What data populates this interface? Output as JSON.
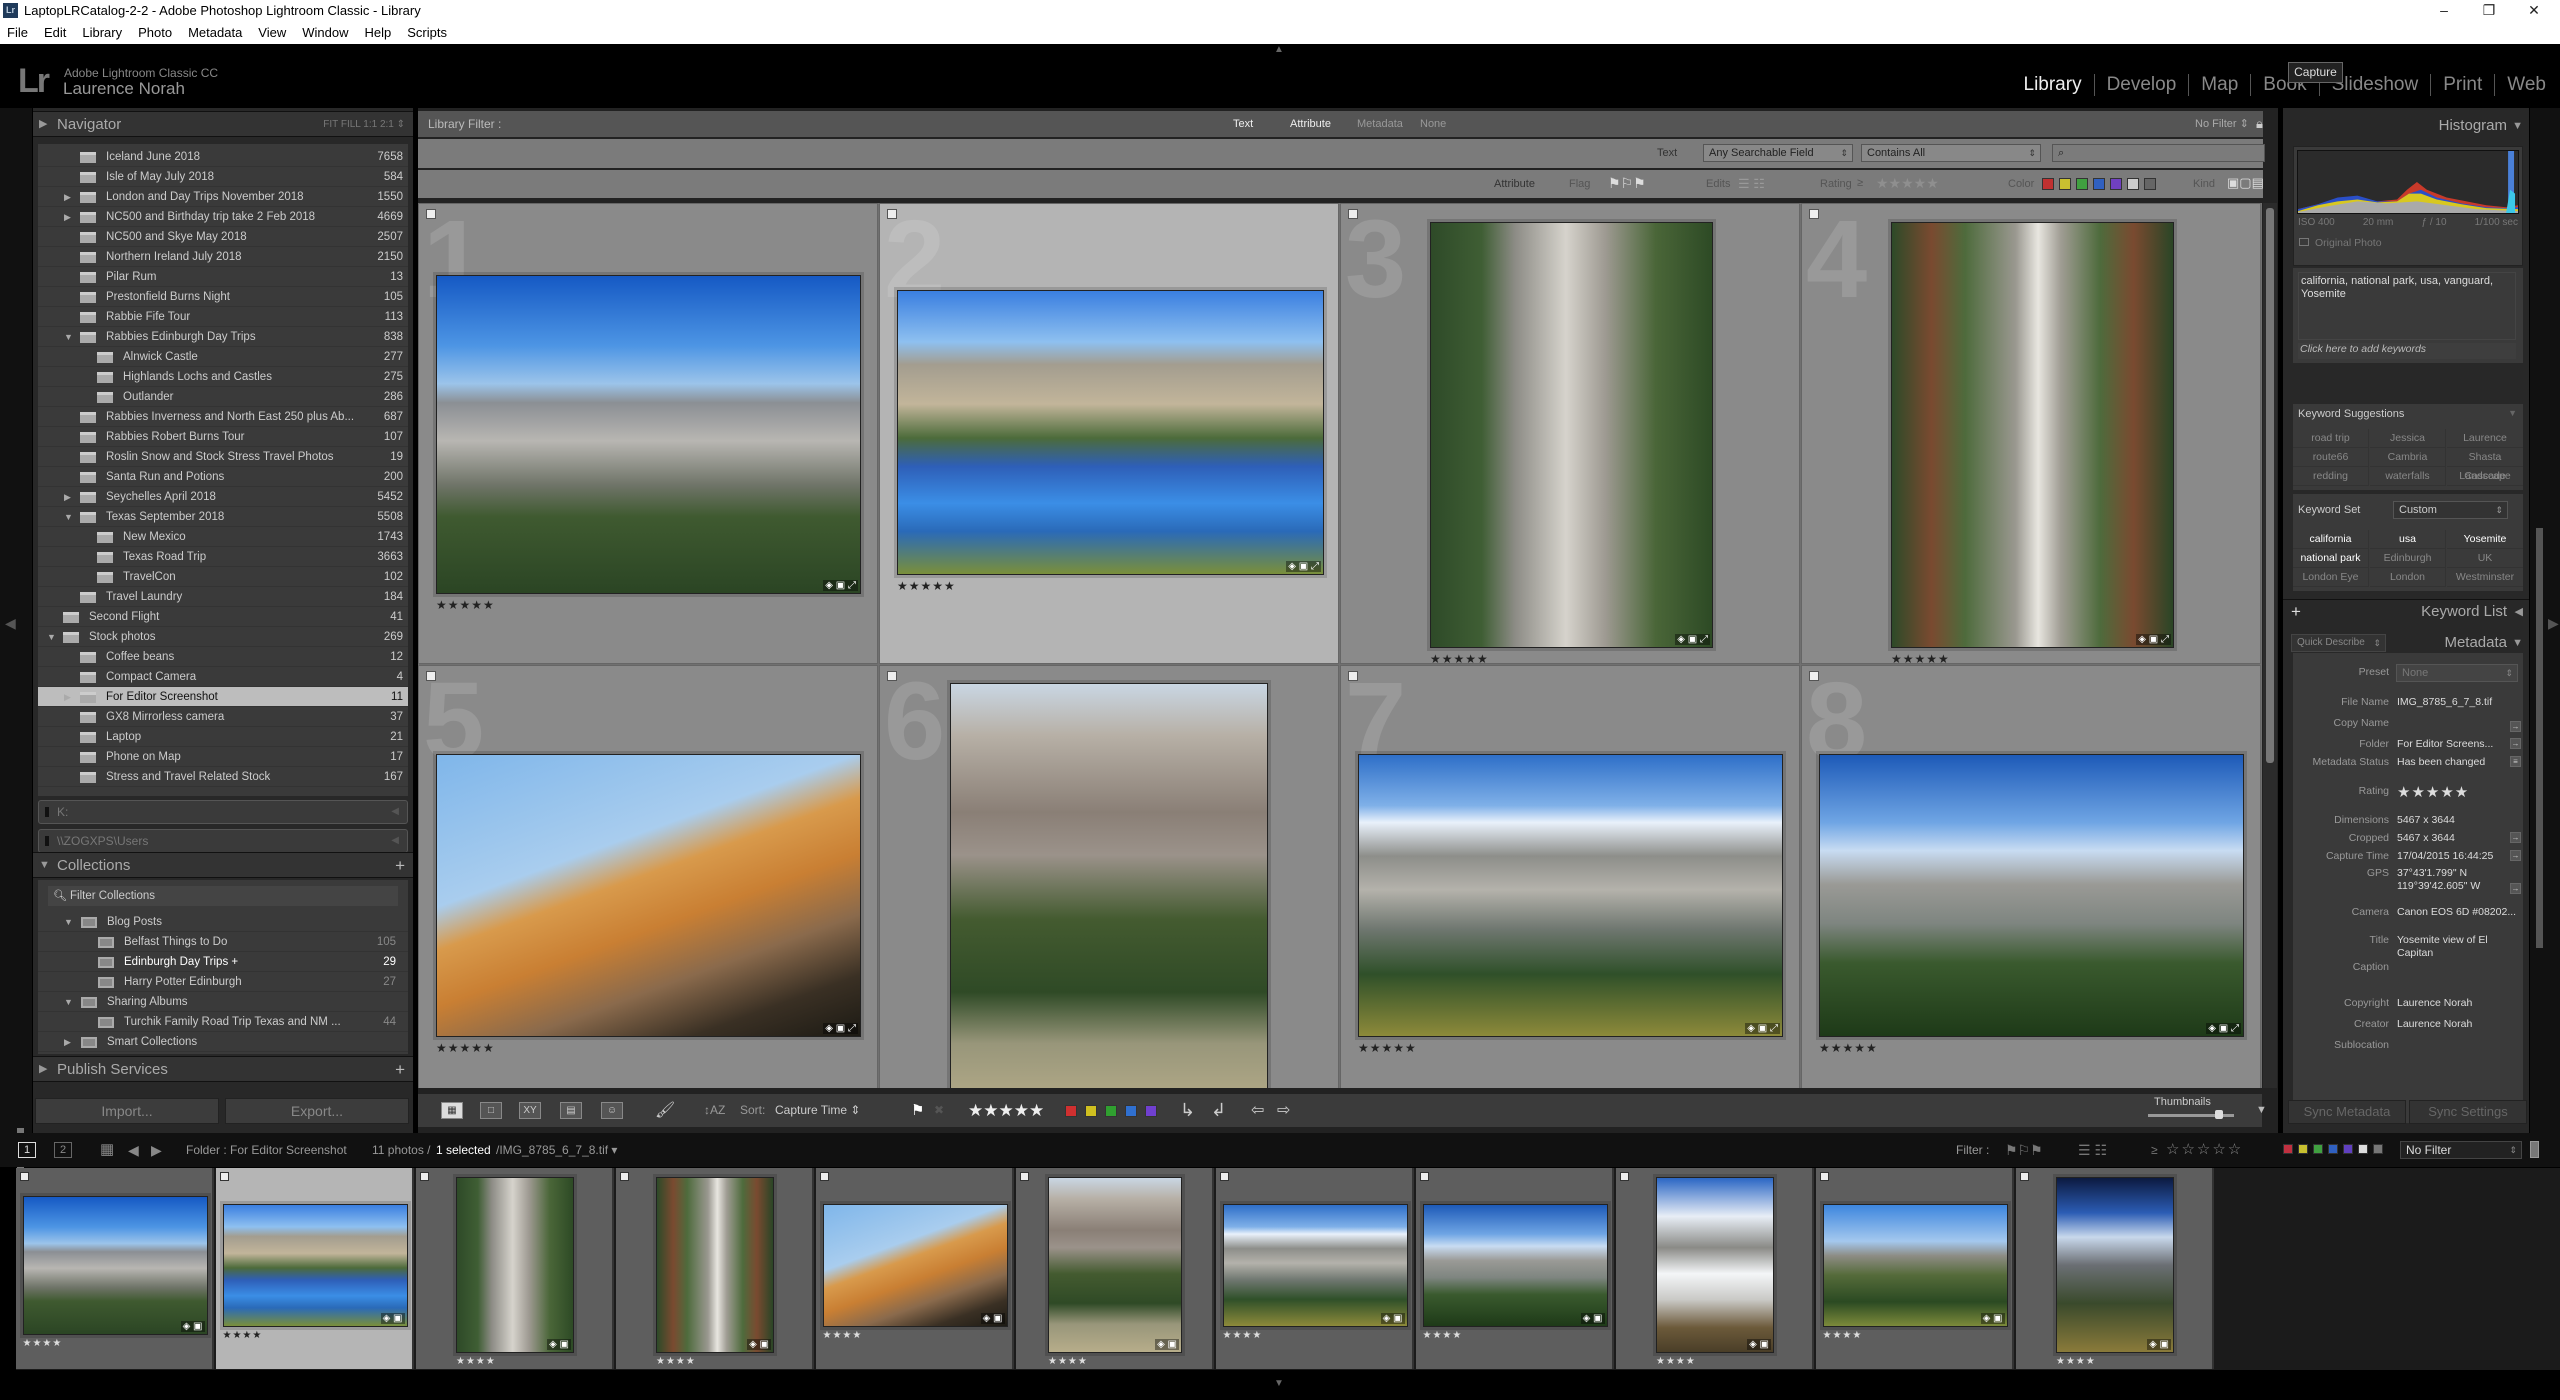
{
  "window": {
    "title": "LaptopLRCatalog-2-2 - Adobe Photoshop Lightroom Classic - Library",
    "app_icon": "Lr",
    "controls": {
      "minimize": "–",
      "maximize": "❐",
      "close": "✕"
    }
  },
  "menu": [
    "File",
    "Edit",
    "Library",
    "Photo",
    "Metadata",
    "View",
    "Window",
    "Help",
    "Scripts"
  ],
  "identity": {
    "logo": "Lr",
    "product": "Adobe Lightroom Classic CC",
    "user": "Laurence Norah"
  },
  "modules": [
    {
      "label": "Library",
      "active": true
    },
    {
      "label": "Develop"
    },
    {
      "label": "Map"
    },
    {
      "label": "Book"
    },
    {
      "label": "Slideshow"
    },
    {
      "label": "Print"
    },
    {
      "label": "Web"
    }
  ],
  "tooltip": "Capture",
  "navigator": {
    "title": "Navigator",
    "zoom_options": "FIT   FILL   1:1   2:1 ⇕"
  },
  "folders": [
    {
      "name": "Iceland June 2018",
      "count": "7658",
      "level": 1
    },
    {
      "name": "Isle of May July 2018",
      "count": "584",
      "level": 1
    },
    {
      "name": "London and Day Trips November 2018",
      "count": "1550",
      "level": 1,
      "state": "collapsed"
    },
    {
      "name": "NC500 and Birthday trip take 2 Feb 2018",
      "count": "4669",
      "level": 1,
      "state": "collapsed"
    },
    {
      "name": "NC500 and Skye May 2018",
      "count": "2507",
      "level": 1
    },
    {
      "name": "Northern Ireland July 2018",
      "count": "2150",
      "level": 1
    },
    {
      "name": "Pilar Rum",
      "count": "13",
      "level": 1
    },
    {
      "name": "Prestonfield Burns Night",
      "count": "105",
      "level": 1
    },
    {
      "name": "Rabbie Fife Tour",
      "count": "113",
      "level": 1
    },
    {
      "name": "Rabbies Edinburgh Day Trips",
      "count": "838",
      "level": 1,
      "state": "expanded"
    },
    {
      "name": "Alnwick Castle",
      "count": "277",
      "level": 2
    },
    {
      "name": "Highlands Lochs and Castles",
      "count": "275",
      "level": 2
    },
    {
      "name": "Outlander",
      "count": "286",
      "level": 2
    },
    {
      "name": "Rabbies Inverness and North East 250 plus Ab...",
      "count": "687",
      "level": 1
    },
    {
      "name": "Rabbies Robert Burns Tour",
      "count": "107",
      "level": 1
    },
    {
      "name": "Roslin Snow and Stock Stress Travel Photos",
      "count": "19",
      "level": 1
    },
    {
      "name": "Santa Run and Potions",
      "count": "200",
      "level": 1
    },
    {
      "name": "Seychelles April 2018",
      "count": "5452",
      "level": 1,
      "state": "collapsed"
    },
    {
      "name": "Texas September 2018",
      "count": "5508",
      "level": 1,
      "state": "expanded"
    },
    {
      "name": "New Mexico",
      "count": "1743",
      "level": 2
    },
    {
      "name": "Texas Road Trip",
      "count": "3663",
      "level": 2
    },
    {
      "name": "TravelCon",
      "count": "102",
      "level": 2
    },
    {
      "name": "Travel Laundry",
      "count": "184",
      "level": 1
    },
    {
      "name": "Second Flight",
      "count": "41",
      "level": 0
    },
    {
      "name": "Stock photos",
      "count": "269",
      "level": 0,
      "state": "expanded"
    },
    {
      "name": "Coffee beans",
      "count": "12",
      "level": 1
    },
    {
      "name": "Compact Camera",
      "count": "4",
      "level": 1
    },
    {
      "name": "For Editor Screenshot",
      "count": "11",
      "level": 1,
      "selected": true,
      "state": "collapsed"
    },
    {
      "name": "GX8 Mirrorless camera",
      "count": "37",
      "level": 1
    },
    {
      "name": "Laptop",
      "count": "21",
      "level": 1
    },
    {
      "name": "Phone on Map",
      "count": "17",
      "level": 1
    },
    {
      "name": "Stress and Travel Related Stock",
      "count": "167",
      "level": 1
    }
  ],
  "volumes": [
    "K:",
    "\\\\ZOGXPS\\Users"
  ],
  "collections": {
    "title": "Collections",
    "filter_placeholder": "Filter Collections",
    "items": [
      {
        "name": "Blog Posts",
        "count": "",
        "level": 0,
        "type": "set",
        "state": "expanded"
      },
      {
        "name": "Belfast Things to Do",
        "count": "105",
        "level": 1,
        "type": "collection"
      },
      {
        "name": "Edinburgh Day Trips  +",
        "count": "29",
        "level": 1,
        "type": "collection",
        "target": true
      },
      {
        "name": "Harry Potter Edinburgh",
        "count": "27",
        "level": 1,
        "type": "collection"
      },
      {
        "name": "Sharing Albums",
        "count": "",
        "level": 0,
        "type": "set",
        "state": "expanded"
      },
      {
        "name": "Turchik Family Road Trip Texas and NM ...",
        "count": "44",
        "level": 1,
        "type": "collection"
      },
      {
        "name": "Smart Collections",
        "count": "",
        "level": 0,
        "type": "set",
        "state": "collapsed"
      }
    ]
  },
  "publish_services": {
    "title": "Publish Services"
  },
  "buttons": {
    "import": "Import...",
    "export": "Export..."
  },
  "library_filter": {
    "label": "Library Filter :",
    "tabs": [
      "Text",
      "Attribute",
      "Metadata",
      "None"
    ],
    "preset": "No Filter ⇕",
    "text_label": "Text",
    "search_field": "Any Searchable Field",
    "search_rule": "Contains All",
    "search_value": "",
    "attribute_label": "Attribute",
    "flag_label": "Flag",
    "edits_label": "Edits",
    "rating_label": "Rating",
    "rating_op": "≥",
    "color_label": "Color",
    "kind_label": "Kind",
    "colors": [
      "#c03030",
      "#c8c030",
      "#40a040",
      "#3060c0",
      "#7040c0",
      "#cccccc",
      "#666666"
    ]
  },
  "grid": [
    {
      "index": "1",
      "rating": "★★★★★",
      "scene": "elcap"
    },
    {
      "index": "2",
      "rating": "★★★★★",
      "scene": "merced",
      "selected": true
    },
    {
      "index": "3",
      "rating": "★★★★★",
      "scene": "falls"
    },
    {
      "index": "4",
      "rating": "★★★★★",
      "scene": "forest"
    },
    {
      "index": "5",
      "rating": "★★★★★",
      "scene": "halfdome"
    },
    {
      "index": "6",
      "rating": "",
      "scene": "yosefalls"
    },
    {
      "index": "7",
      "rating": "★★★★★",
      "scene": "glacier"
    },
    {
      "index": "8",
      "rating": "★★★★★",
      "scene": "glacier2"
    }
  ],
  "toolbar": {
    "sort_label": "Sort:",
    "sort_value": "Capture Time ⇕",
    "rating": "★★★★★",
    "label_colors": [
      "#d03030",
      "#d0c020",
      "#30a030",
      "#3070d0",
      "#7040d0"
    ],
    "thumbnails_label": "Thumbnails",
    "thumbnail_size": 0.82
  },
  "histogram": {
    "title": "Histogram",
    "iso": "ISO 400",
    "focal": "20 mm",
    "aperture": "ƒ / 10",
    "shutter": "1/100 sec",
    "original_photo": "Original Photo"
  },
  "keywords": {
    "text": "california, national park, usa, vanguard, Yosemite",
    "add_placeholder": "Click here to add keywords",
    "suggestions_title": "Keyword Suggestions",
    "suggestions": [
      "road trip",
      "Jessica",
      "Laurence",
      "route66",
      "Cambria",
      "Shasta Cascade",
      "redding",
      "waterfalls",
      "Landscape"
    ],
    "set_label": "Keyword Set",
    "set_value": "Custom",
    "set_items": [
      {
        "label": "california",
        "active": true
      },
      {
        "label": "usa",
        "active": true
      },
      {
        "label": "Yosemite",
        "active": true
      },
      {
        "label": "national park",
        "active": true
      },
      {
        "label": "Edinburgh"
      },
      {
        "label": "UK"
      },
      {
        "label": "London Eye"
      },
      {
        "label": "London"
      },
      {
        "label": "Westminster"
      }
    ],
    "list_title": "Keyword List"
  },
  "metadata": {
    "title": "Metadata",
    "quick_describe": "Quick Describe",
    "preset_label": "Preset",
    "preset_value": "None",
    "file_name": "IMG_8785_6_7_8.tif",
    "copy_name": "",
    "folder": "For Editor Screens...",
    "status": "Has been changed",
    "rating": "★★★★★",
    "dimensions": "5467 x 3644",
    "cropped": "5467 x 3644",
    "capture_time": "17/04/2015 16:44:25",
    "gps_lat": "37°43'1.799\" N",
    "gps_lon": "119°39'42.605\" W",
    "camera": "Canon EOS 6D #08202...",
    "title_value": "Yosemite view of El Capitan",
    "caption": "",
    "copyright": "Laurence Norah",
    "creator": "Laurence Norah",
    "sublocation": "",
    "labels": {
      "preset": "Preset",
      "file_name": "File Name",
      "copy_name": "Copy Name",
      "folder": "Folder",
      "status": "Metadata Status",
      "rating": "Rating",
      "dimensions": "Dimensions",
      "cropped": "Cropped",
      "capture_time": "Capture Time",
      "gps": "GPS",
      "camera": "Camera",
      "title": "Title",
      "caption": "Caption",
      "copyright": "Copyright",
      "creator": "Creator",
      "sublocation": "Sublocation"
    }
  },
  "sync": {
    "metadata": "Sync Metadata",
    "settings": "Sync Settings"
  },
  "filmstrip_header": {
    "view1": "1",
    "view2": "2",
    "source": "Folder : For Editor Screenshot",
    "count": "11 photos /",
    "selected": "1 selected",
    "file": "/IMG_8785_6_7_8.tif ▾",
    "filter_label": "Filter :",
    "rating_op": "≥",
    "filter_value": "No Filter",
    "colors": [
      "#c03040",
      "#c8c030",
      "#40a040",
      "#3060c0",
      "#6040c0",
      "#dddddd",
      "#777777"
    ]
  },
  "filmstrip": [
    {
      "scene": "elcap",
      "rating": "★★★★"
    },
    {
      "scene": "merced",
      "rating": "★★★★",
      "selected": true
    },
    {
      "scene": "falls",
      "rating": "★★★★"
    },
    {
      "scene": "forest",
      "rating": "★★★★"
    },
    {
      "scene": "halfdome",
      "rating": "★★★★"
    },
    {
      "scene": "yosefalls",
      "rating": "★★★★"
    },
    {
      "scene": "glacier",
      "rating": "★★★★"
    },
    {
      "scene": "glacier2",
      "rating": "★★★★"
    },
    {
      "scene": "vernal",
      "rating": "★★★★"
    },
    {
      "scene": "yose2",
      "rating": "★★★★"
    },
    {
      "scene": "night",
      "rating": "★★★★"
    }
  ]
}
